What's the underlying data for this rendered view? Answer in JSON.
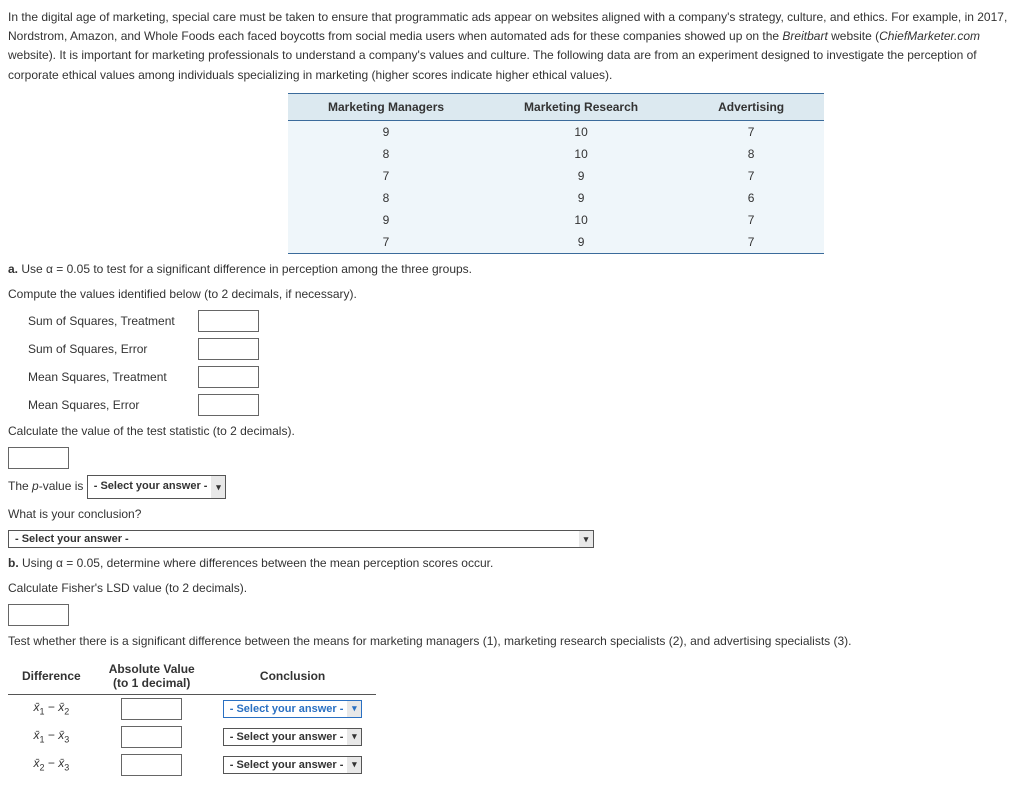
{
  "intro": {
    "p1_a": "In the digital age of marketing, special care must be taken to ensure that programmatic ads appear on websites aligned with a company's strategy, culture, and ethics. For example, in ",
    "year": "2017",
    "p1_b": ", Nordstrom, Amazon, and Whole Foods each faced boycotts from social media users when automated ads for these companies showed up on the ",
    "site": "Breitbart",
    "p1_c": " website (",
    "source": "ChiefMarketer.com",
    "p1_d": " website). It is important for marketing professionals to understand a company's values and culture. The following data are from an experiment designed to investigate the perception of corporate ethical values among individuals specializing in marketing (higher scores indicate higher ethical values)."
  },
  "table": {
    "headers": [
      "Marketing Managers",
      "Marketing Research",
      "Advertising"
    ],
    "rows": [
      [
        "9",
        "10",
        "7"
      ],
      [
        "8",
        "10",
        "8"
      ],
      [
        "7",
        "9",
        "7"
      ],
      [
        "8",
        "9",
        "6"
      ],
      [
        "9",
        "10",
        "7"
      ],
      [
        "7",
        "9",
        "7"
      ]
    ]
  },
  "a": {
    "q1_a": "a. ",
    "q1_b": "Use α = 0.05 to test for a significant difference in perception among the three groups.",
    "q2": "Compute the values identified below (to 2 decimals, if necessary).",
    "labels": {
      "sst": "Sum of Squares, Treatment",
      "sse": "Sum of Squares, Error",
      "mst": "Mean Squares, Treatment",
      "mse": "Mean Squares, Error"
    },
    "calc": "Calculate the value of the test statistic (to 2 decimals).",
    "pval_a": "The ",
    "pval_p": "p",
    "pval_b": "-value is ",
    "select_ph": "- Select your answer -",
    "concl": "What is your conclusion?"
  },
  "b": {
    "intro": "b. Using α = 0.05, determine where differences between the mean perception scores occur.",
    "calc": "Calculate Fisher's LSD value (to 2 decimals).",
    "test": "Test whether there is a significant difference between the means for marketing managers (1), marketing research specialists (2), and advertising specialists (3).",
    "headers": {
      "diff": "Difference",
      "abs_a": "Absolute Value",
      "abs_b": "(to 1 decimal)",
      "concl": "Conclusion"
    },
    "rows": [
      {
        "a": "1",
        "b": "2"
      },
      {
        "a": "1",
        "b": "3"
      },
      {
        "a": "2",
        "b": "3"
      }
    ]
  }
}
